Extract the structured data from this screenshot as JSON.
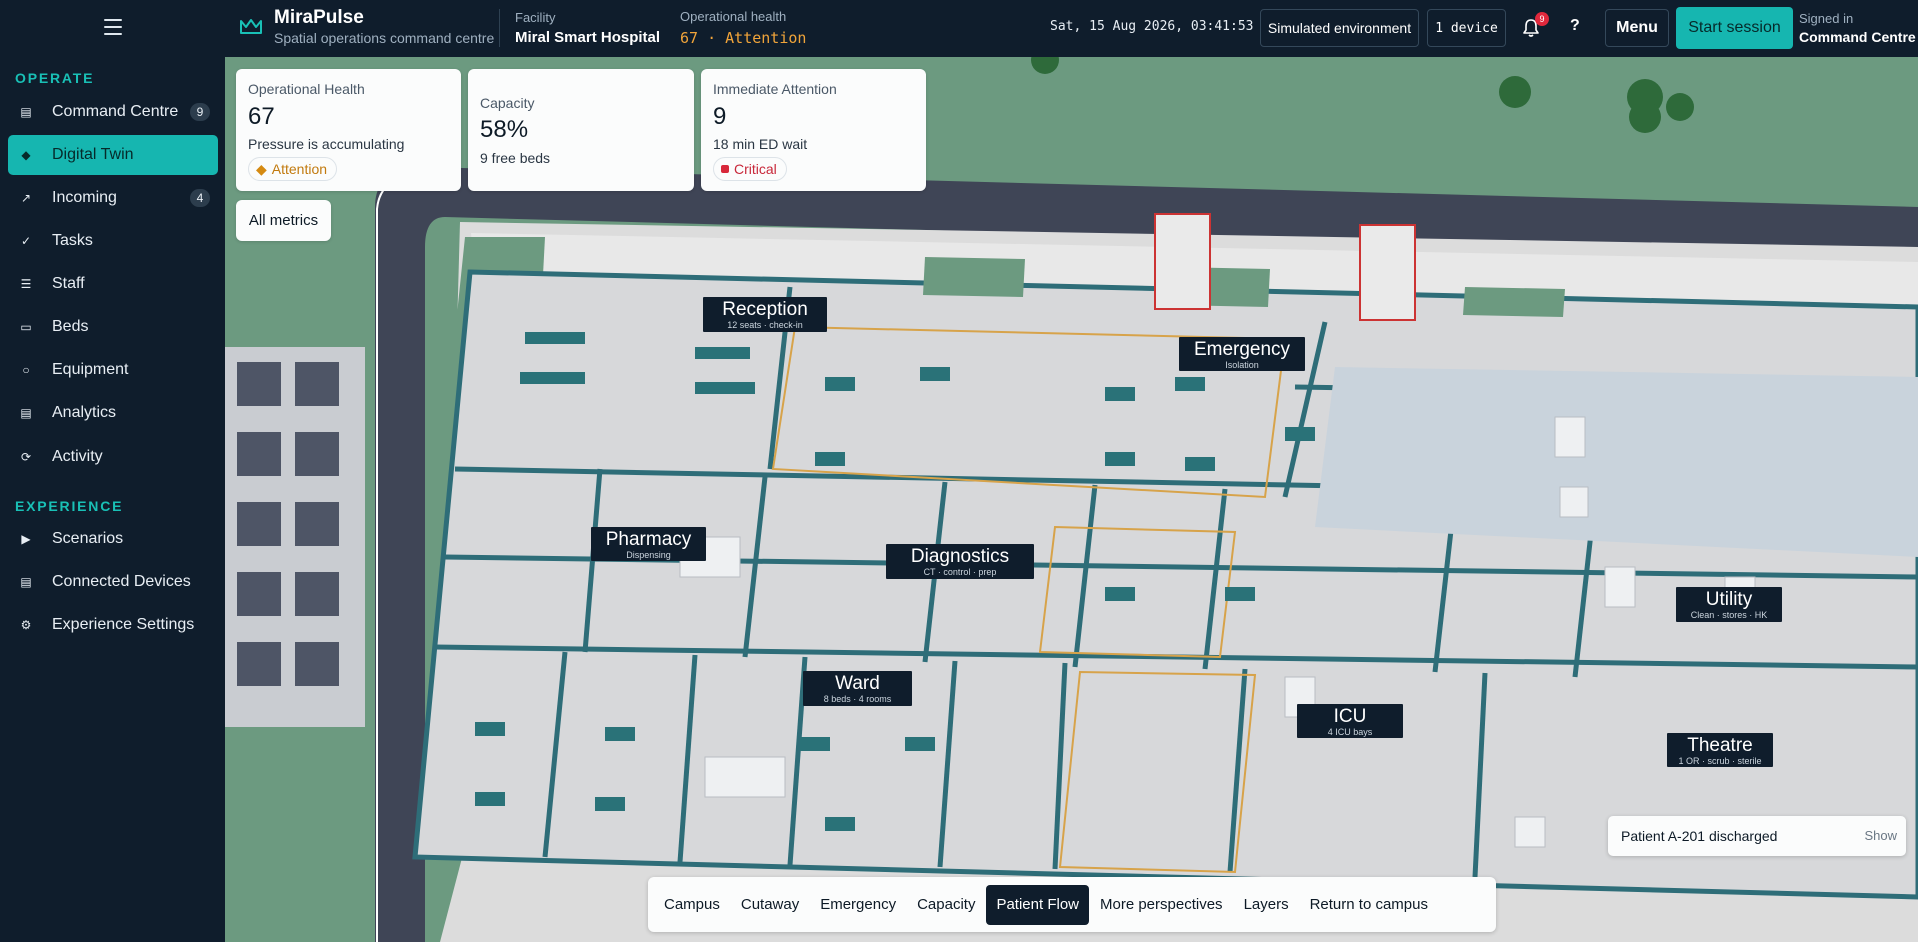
{
  "brand": {
    "name": "MiraPulse",
    "subtitle": "Spatial operations command centre"
  },
  "header": {
    "facility_label": "Facility",
    "facility_value": "Miral Smart Hospital",
    "health_label": "Operational health",
    "health_value": "67 · Attention",
    "clock": "Sat, 15 Aug 2026, 03:41:53",
    "environment": "Simulated environment",
    "devices": "1 device",
    "notification_count": "9",
    "help": "?",
    "menu": "Menu",
    "start_session": "Start session",
    "signed_in_label": "Signed in",
    "signed_in_value": "Command Centre"
  },
  "sidebar": {
    "operate_header": "OPERATE",
    "experience_header": "EXPERIENCE",
    "operate": [
      {
        "label": "Command Centre",
        "badge": "9",
        "icon": "command-centre-icon"
      },
      {
        "label": "Digital Twin",
        "badge": "",
        "icon": "digital-twin-icon"
      },
      {
        "label": "Incoming",
        "badge": "4",
        "icon": "incoming-arrow-icon"
      },
      {
        "label": "Tasks",
        "badge": "",
        "icon": "check-icon"
      },
      {
        "label": "Staff",
        "badge": "",
        "icon": "list-icon"
      },
      {
        "label": "Beds",
        "badge": "",
        "icon": "bed-icon"
      },
      {
        "label": "Equipment",
        "badge": "",
        "icon": "circle-icon"
      },
      {
        "label": "Analytics",
        "badge": "",
        "icon": "analytics-icon"
      },
      {
        "label": "Activity",
        "badge": "",
        "icon": "refresh-icon"
      }
    ],
    "experience": [
      {
        "label": "Scenarios",
        "icon": "play-icon"
      },
      {
        "label": "Connected Devices",
        "icon": "device-icon"
      },
      {
        "label": "Experience Settings",
        "icon": "gear-icon"
      }
    ]
  },
  "cards": {
    "health": {
      "title": "Operational Health",
      "value": "67",
      "sub": "Pressure is accumulating",
      "badge": "Attention"
    },
    "capacity": {
      "title": "Capacity",
      "value": "58%",
      "sub": "9 free beds"
    },
    "attention": {
      "title": "Immediate Attention",
      "value": "9",
      "sub": "18 min ED wait",
      "badge": "Critical"
    }
  },
  "all_metrics": "All metrics",
  "rooms": {
    "reception": {
      "name": "Reception",
      "desc": "12 seats · check-in"
    },
    "emergency": {
      "name": "Emergency",
      "desc": "Isolation"
    },
    "pharmacy": {
      "name": "Pharmacy",
      "desc": "Dispensing"
    },
    "diagnostics": {
      "name": "Diagnostics",
      "desc": "CT · control · prep"
    },
    "ward": {
      "name": "Ward",
      "desc": "8 beds · 4 rooms"
    },
    "icu": {
      "name": "ICU",
      "desc": "4 ICU bays"
    },
    "utility": {
      "name": "Utility",
      "desc": "Clean · stores · HK"
    },
    "theatre": {
      "name": "Theatre",
      "desc": "1 OR · scrub · sterile"
    }
  },
  "perspectives": [
    "Campus",
    "Cutaway",
    "Emergency",
    "Capacity",
    "Patient Flow",
    "More perspectives",
    "Layers",
    "Return to campus"
  ],
  "active_perspective": "Patient Flow",
  "toast": {
    "text": "Patient A-201 discharged",
    "action": "Show"
  },
  "colors": {
    "accent": "#16b6b0",
    "attention": "#d58a12",
    "critical": "#d8283a",
    "navy": "#0f1d2c",
    "grass": "#6c9a80"
  }
}
